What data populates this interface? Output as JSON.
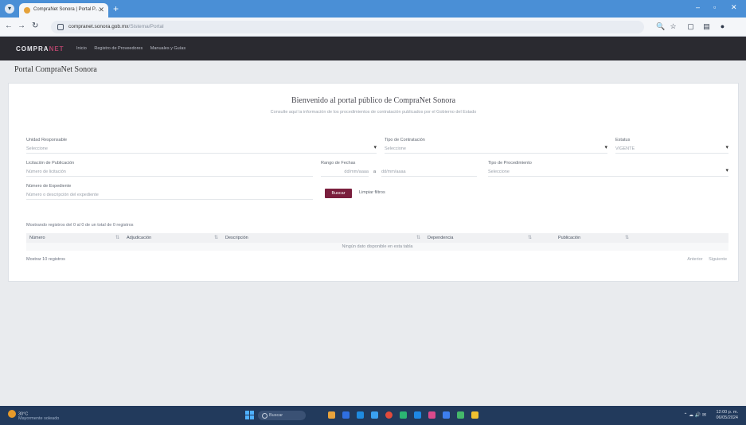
{
  "browser": {
    "tab_title": "CompraNet Sonora | Portal P...",
    "tab_menu_glyph": "▾",
    "tab_close": "✕",
    "new_tab": "+",
    "url_domain": "compranet.sonora.gob.mx",
    "url_path": "/Sistema/Portal",
    "win_min": "–",
    "win_max": "▫",
    "win_close": "✕",
    "back": "←",
    "forward": "→",
    "reload": "↻",
    "toolbar_icons": [
      "🔍",
      "☆",
      "▢",
      "▤",
      "●"
    ]
  },
  "site": {
    "logo_main": "COMPRA",
    "logo_accent": "NET",
    "nav": [
      "Inicio",
      "Registro de Proveedores",
      "Manuales y Guías"
    ]
  },
  "page": {
    "title": "Portal CompraNet Sonora"
  },
  "form": {
    "welcome": "Bienvenido al portal público de CompraNet Sonora",
    "welcome_sub": "Consulte aquí la información de los procedimientos de contratación publicados por el Gobierno del Estado",
    "unidad_label": "Unidad Responsable",
    "unidad_value": "Seleccione",
    "tipo_label": "Tipo de Contratación",
    "tipo_value": "Seleccione",
    "estatus_label": "Estatus",
    "estatus_value": "VIGENTE",
    "licitacion_label": "Licitación de Publicación",
    "licitacion_placeholder": "Número de licitación",
    "fecha_label": "Rango de Fechas",
    "fecha_desde": "dd/mm/aaaa",
    "fecha_sep": "a",
    "fecha_hasta": "dd/mm/aaaa",
    "tipo_proc_label": "Tipo de Procedimiento",
    "tipo_proc_value": "Seleccione",
    "numero_label": "Número de Expediente",
    "numero_placeholder": "Número o descripción del expediente",
    "buscar": "Buscar",
    "limpiar": "Limpiar filtros"
  },
  "results": {
    "caption": "Mostrando registros del 0 al 0 de un total de 0 registros",
    "columns": [
      "Número",
      "Adjudicación",
      "Descripción",
      "Dependencia",
      "Publicación"
    ],
    "empty": "Ningún dato disponible en esta tabla",
    "page_size_label": "Mostrar",
    "page_size": "10",
    "page_size_suffix": "registros",
    "prev": "Anterior",
    "next": "Siguiente"
  },
  "taskbar": {
    "weather_temp": "30°C",
    "weather_desc": "Mayormente soleado",
    "search": "Buscar",
    "time": "12:00 p. m.",
    "date": "06/05/2024",
    "tray": "⌃  ☁  🔊  ✉"
  },
  "colors": {
    "brand": "#7a1f3d",
    "header_bg": "#2a2a30",
    "tabstrip": "#4a8fd6",
    "taskbar": "#223a5c"
  }
}
